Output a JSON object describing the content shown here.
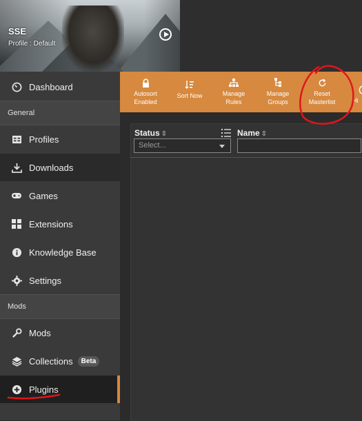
{
  "header": {
    "game_title": "SSE",
    "profile_label": "Profile : Default"
  },
  "sidebar": {
    "dashboard": "Dashboard",
    "sections": {
      "general": "General",
      "mods": "Mods"
    },
    "general_items": [
      {
        "label": "Profiles",
        "icon": "profiles-icon"
      },
      {
        "label": "Downloads",
        "icon": "download-icon"
      },
      {
        "label": "Games",
        "icon": "gamepad-icon"
      },
      {
        "label": "Extensions",
        "icon": "extensions-icon"
      },
      {
        "label": "Knowledge Base",
        "icon": "info-icon"
      },
      {
        "label": "Settings",
        "icon": "gear-icon"
      }
    ],
    "mods_items": [
      {
        "label": "Mods",
        "icon": "wrench-icon"
      },
      {
        "label": "Collections",
        "icon": "layers-icon",
        "badge": "Beta"
      },
      {
        "label": "Plugins",
        "icon": "plus-circle-icon"
      }
    ],
    "active_item": "Plugins"
  },
  "toolbar": {
    "buttons": [
      {
        "line1": "Autosort",
        "line2": "Enabled",
        "icon": "lock-icon"
      },
      {
        "line1": "Sort Now",
        "line2": "",
        "icon": "sort-icon"
      },
      {
        "line1": "Manage",
        "line2": "Rules",
        "icon": "hierarchy-icon"
      },
      {
        "line1": "Manage",
        "line2": "Groups",
        "icon": "groups-icon"
      },
      {
        "line1": "Reset",
        "line2": "Masterlist",
        "icon": "refresh-icon"
      },
      {
        "line1": "Hi",
        "line2": "",
        "icon": "hidden-icon"
      }
    ]
  },
  "table": {
    "columns": {
      "status": "Status",
      "name": "Name"
    },
    "status_filter_placeholder": "Select..."
  },
  "colors": {
    "accent": "#d6893f",
    "annotation": "#e0161b"
  }
}
